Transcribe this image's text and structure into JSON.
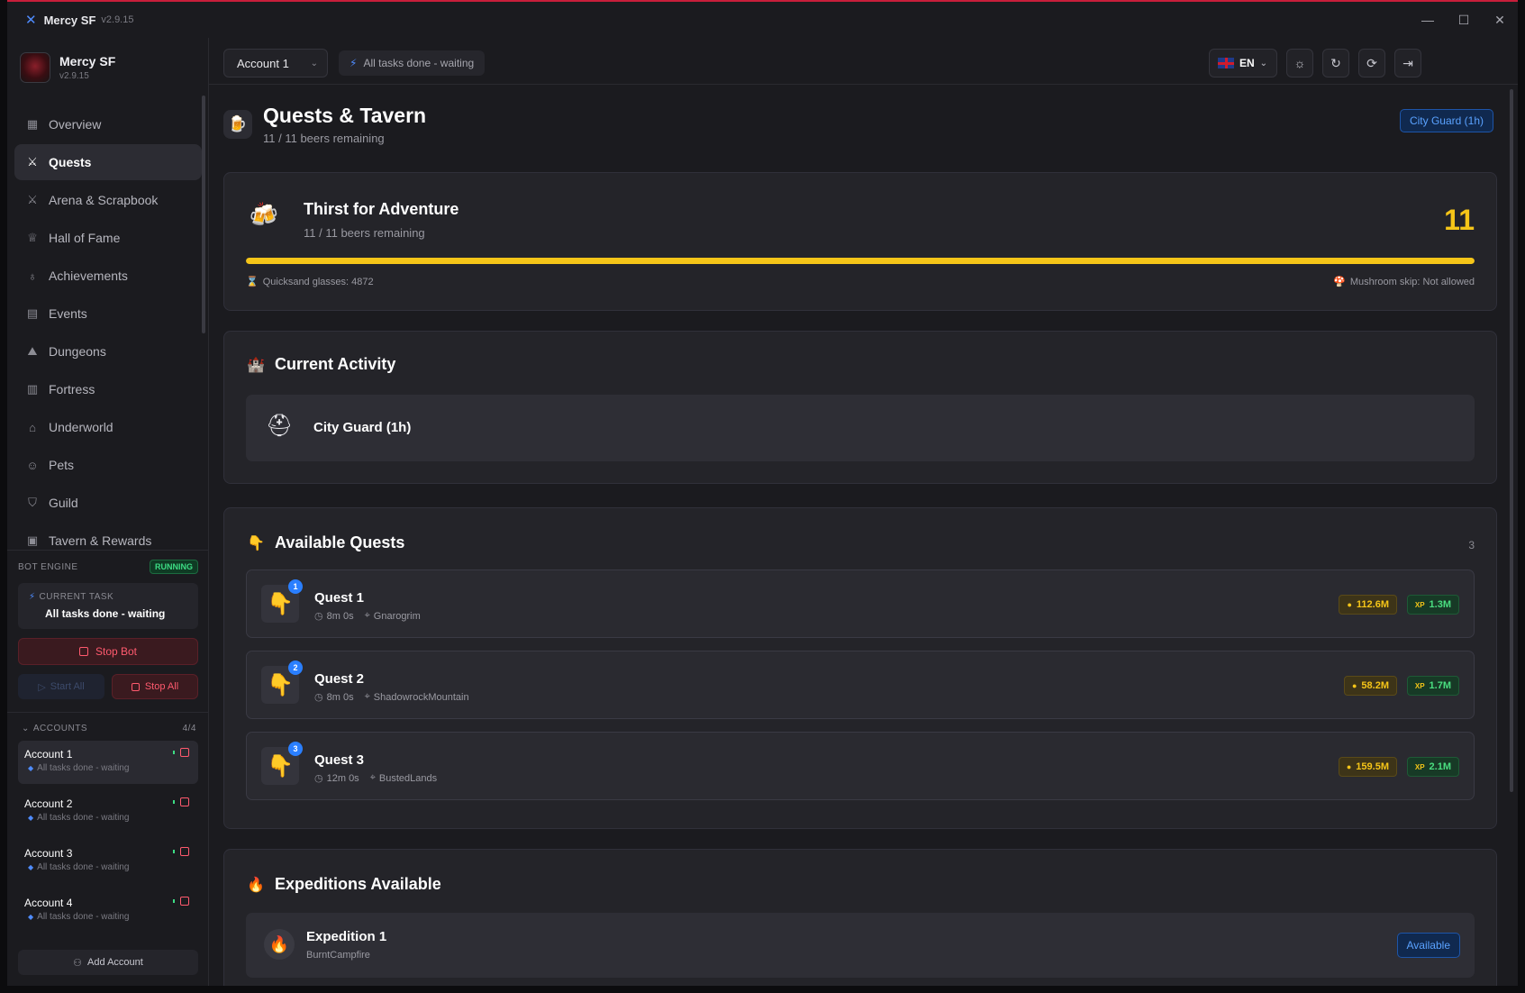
{
  "window": {
    "app_name": "Mercy SF",
    "version": "v2.9.15",
    "minimize": "—",
    "maximize": "☐",
    "close": "✕"
  },
  "sidebar": {
    "profile": {
      "name": "Mercy SF",
      "version": "v2.9.15"
    },
    "nav": [
      {
        "label": "Overview",
        "icon": "grid-icon",
        "glyph": "▦"
      },
      {
        "label": "Quests",
        "icon": "swords-icon",
        "glyph": "⚔"
      },
      {
        "label": "Arena & Scrapbook",
        "icon": "swords-icon",
        "glyph": "⚔"
      },
      {
        "label": "Hall of Fame",
        "icon": "trophy-icon",
        "glyph": "♕"
      },
      {
        "label": "Achievements",
        "icon": "award-icon",
        "glyph": "♁"
      },
      {
        "label": "Events",
        "icon": "calendar-icon",
        "glyph": "▤"
      },
      {
        "label": "Dungeons",
        "icon": "mountain-icon",
        "glyph": "⛰"
      },
      {
        "label": "Fortress",
        "icon": "castle-icon",
        "glyph": "▥"
      },
      {
        "label": "Underworld",
        "icon": "home-icon",
        "glyph": "⌂"
      },
      {
        "label": "Pets",
        "icon": "cat-icon",
        "glyph": "☺"
      },
      {
        "label": "Guild",
        "icon": "shield-icon",
        "glyph": "⛉"
      },
      {
        "label": "Tavern & Rewards",
        "icon": "gift-icon",
        "glyph": "▣"
      }
    ],
    "engine": {
      "label": "BOT ENGINE",
      "status": "RUNNING",
      "current_task_label": "CURRENT TASK",
      "current_task_value": "All tasks done - waiting",
      "stop_bot": "Stop Bot",
      "start_all": "Start All",
      "stop_all": "Stop All",
      "start_glyph": "▷"
    },
    "accounts_header": {
      "label": "ACCOUNTS",
      "count": "4/4",
      "chevron": "⌄"
    },
    "accounts": [
      {
        "name": "Account 1",
        "status": "All tasks done - waiting"
      },
      {
        "name": "Account 2",
        "status": "All tasks done - waiting"
      },
      {
        "name": "Account 3",
        "status": "All tasks done - waiting"
      },
      {
        "name": "Account 4",
        "status": "All tasks done - waiting"
      }
    ],
    "add_account": "Add Account",
    "add_glyph": "⚇"
  },
  "topbar": {
    "account_select": "Account 1",
    "chevron": "⌄",
    "status": "All tasks done - waiting",
    "pulse_glyph": "⚡",
    "language": "EN",
    "icons": [
      {
        "name": "theme-sun-icon",
        "glyph": "☼"
      },
      {
        "name": "refresh-icon",
        "glyph": "↻"
      },
      {
        "name": "sync-icon",
        "glyph": "⟳"
      },
      {
        "name": "logout-icon",
        "glyph": "⇥"
      }
    ]
  },
  "page": {
    "title": "Quests & Tavern",
    "subtitle": "11 / 11 beers remaining",
    "activity_pill": "City Guard (1h)",
    "icon_glyph": "🍺"
  },
  "thirst": {
    "title": "Thirst for Adventure",
    "subtitle": "11 / 11 beers remaining",
    "count": "11",
    "progress": 1.0,
    "quicksand": "Quicksand glasses: 4872",
    "mushroom": "Mushroom skip: Not allowed",
    "icon_glyph": "🍻",
    "quicksand_glyph": "⌛",
    "mushroom_glyph": "🍄"
  },
  "current_activity": {
    "title": "Current Activity",
    "value": "City Guard (1h)",
    "title_glyph": "🏰",
    "value_glyph": "⛑"
  },
  "available_quests": {
    "title": "Available Quests",
    "count": "3",
    "title_glyph": "👇",
    "clock_glyph": "◷",
    "pin_glyph": "⌖",
    "gold_glyph": "●",
    "xp_glyph": "XP",
    "items": [
      {
        "badge": "1",
        "name": "Quest 1",
        "time": "8m 0s",
        "location": "Gnarogrim",
        "gold": "112.6M",
        "xp": "1.3M",
        "glyph": "👇"
      },
      {
        "badge": "2",
        "name": "Quest 2",
        "time": "8m 0s",
        "location": "ShadowrockMountain",
        "gold": "58.2M",
        "xp": "1.7M",
        "glyph": "👇"
      },
      {
        "badge": "3",
        "name": "Quest 3",
        "time": "12m 0s",
        "location": "BustedLands",
        "gold": "159.5M",
        "xp": "2.1M",
        "glyph": "👇"
      }
    ]
  },
  "expeditions": {
    "title": "Expeditions Available",
    "title_glyph": "🔥",
    "items": [
      {
        "name": "Expedition 1",
        "location": "BurntCampfire",
        "status": "Available",
        "glyph": "🔥"
      }
    ]
  }
}
